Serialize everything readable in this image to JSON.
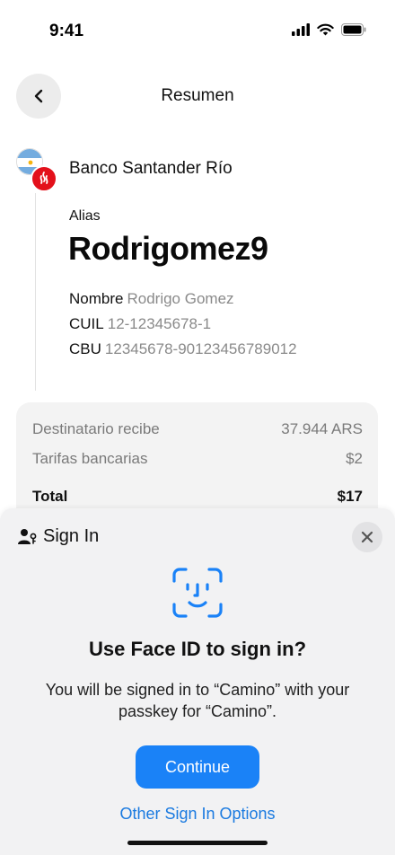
{
  "status_bar": {
    "time": "9:41"
  },
  "header": {
    "title": "Resumen"
  },
  "bank": {
    "name": "Banco Santander Río"
  },
  "recipient": {
    "alias_label": "Alias",
    "alias": "Rodrigomez9",
    "name_label": "Nombre",
    "name": "Rodrigo Gomez",
    "cuil_label": "CUIL",
    "cuil": "12-12345678-1",
    "cbu_label": "CBU",
    "cbu": "12345678-90123456789012"
  },
  "summary": {
    "rows": [
      {
        "label": "Destinatario recibe",
        "amount": "37.944 ARS"
      },
      {
        "label": "Tarifas bancarias",
        "amount": "$2"
      }
    ],
    "total_label": "Total",
    "total_amount": "$17"
  },
  "sheet": {
    "title": "Sign In",
    "heading": "Use Face ID to sign in?",
    "message": "You will be signed in to “Camino” with your passkey for “Camino”.",
    "continue_label": "Continue",
    "other_options_label": "Other Sign In Options"
  },
  "colors": {
    "accent": "#1a82f7",
    "link": "#1a7ae0",
    "bank_red": "#e3101b",
    "card_bg": "#f3f3f3",
    "sheet_bg": "#f2f2f3"
  }
}
